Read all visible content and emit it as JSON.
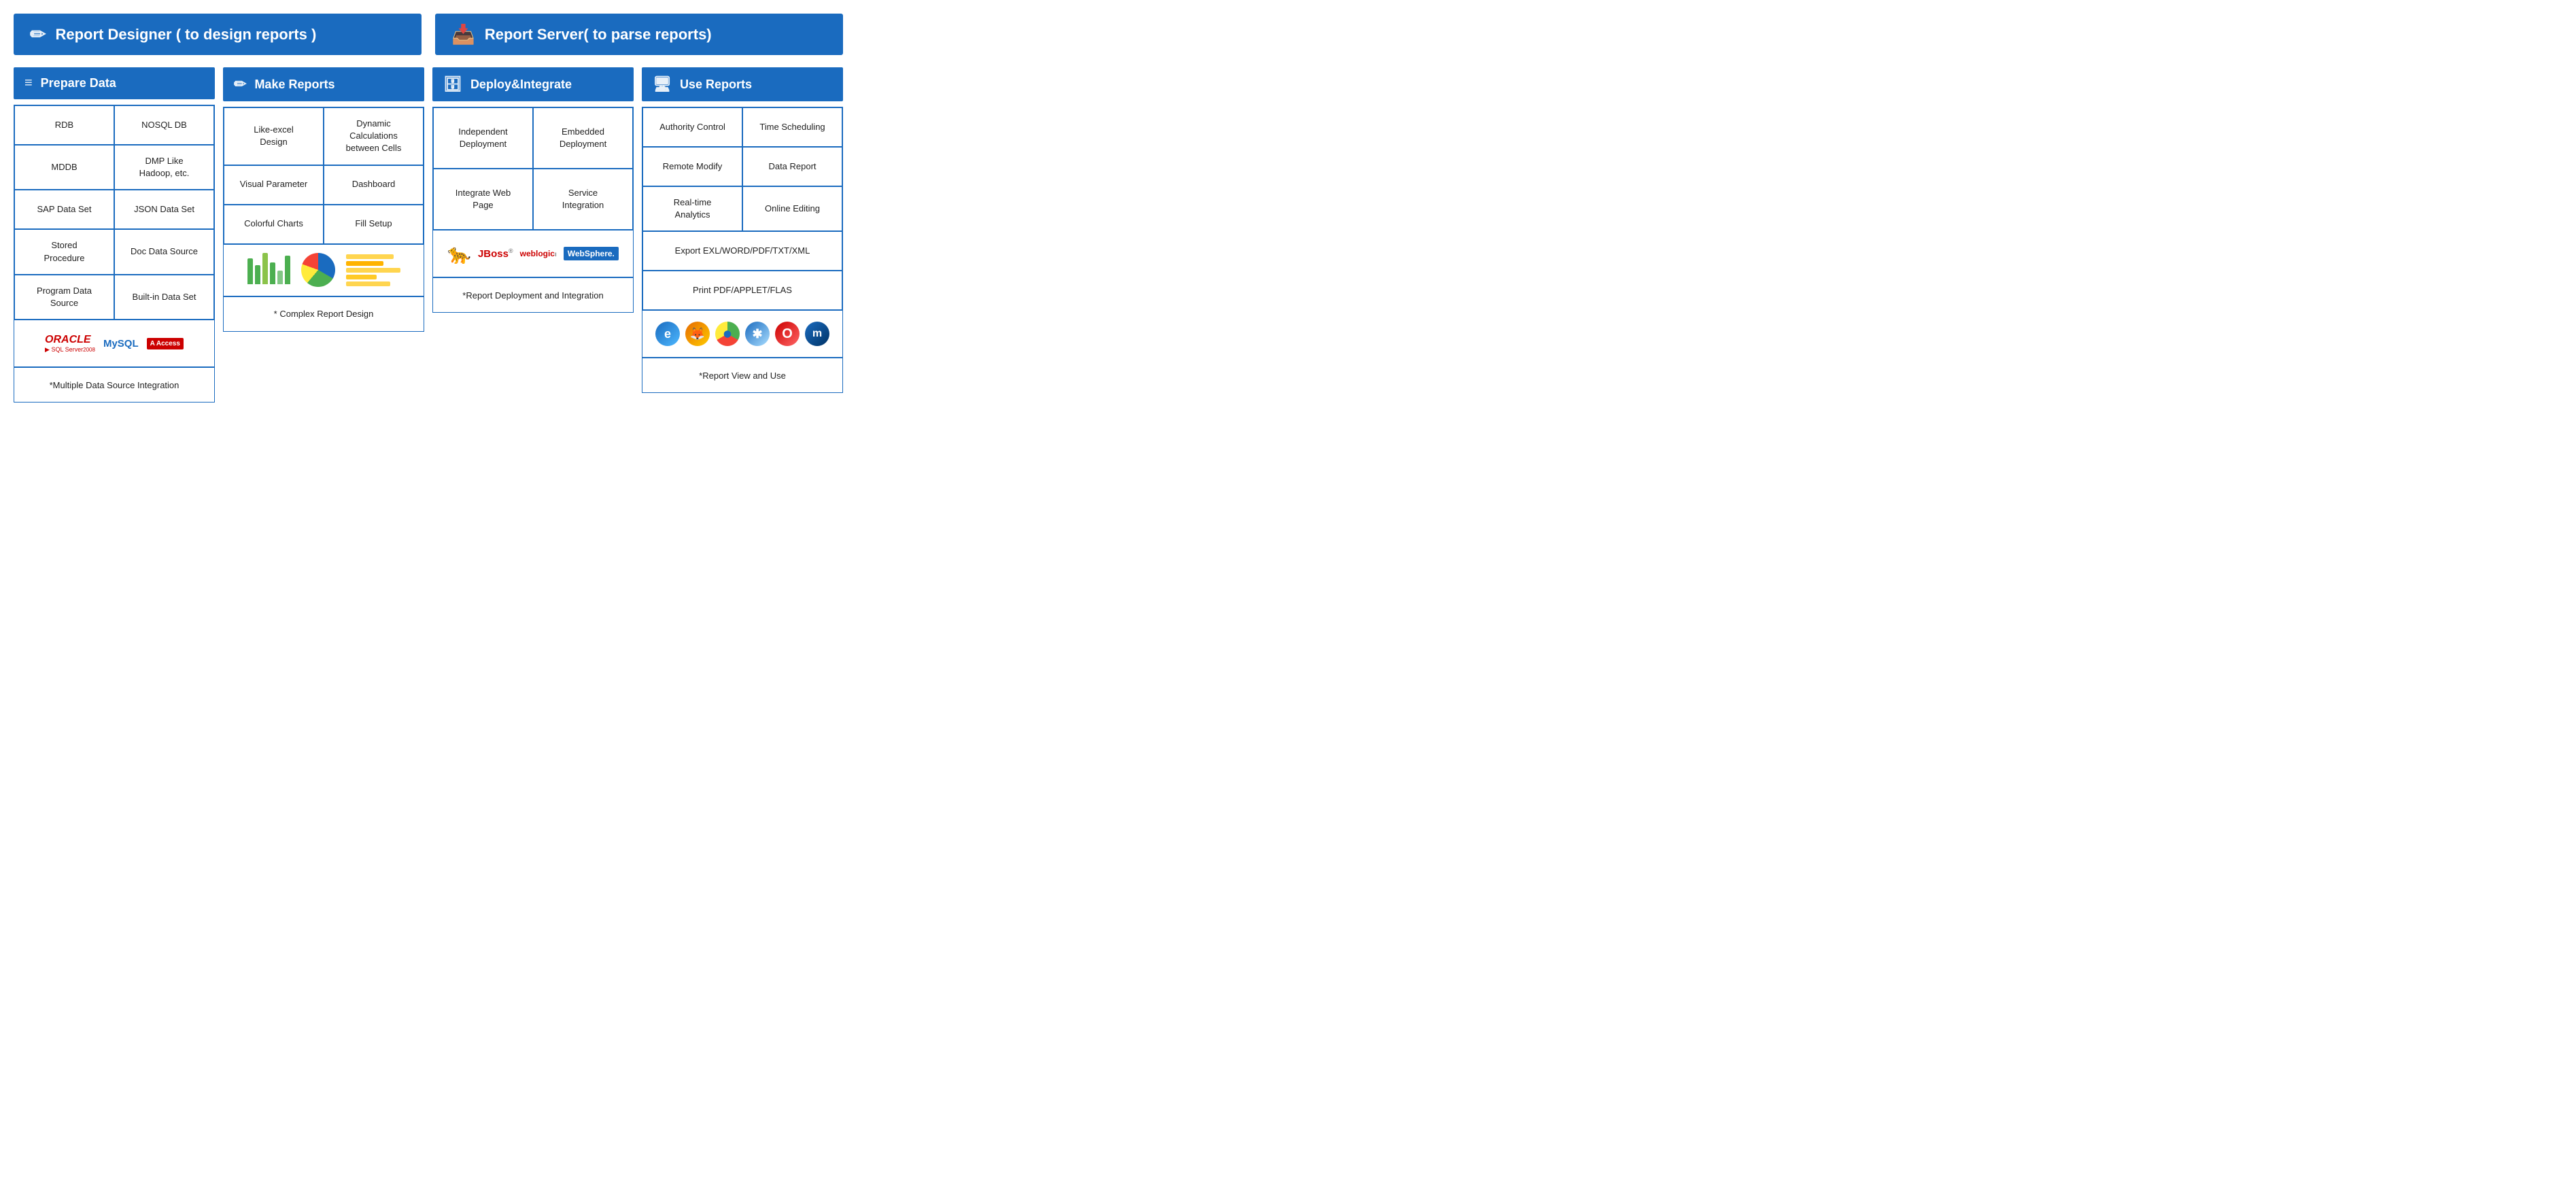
{
  "banners": {
    "designer": {
      "label": "Report Designer ( to design reports )",
      "icon": "✏️"
    },
    "server": {
      "label": "Report Server( to parse reports)",
      "icon": "📥"
    }
  },
  "sections": {
    "prepare_data": {
      "header": "Prepare Data",
      "icon": "≡",
      "features": [
        {
          "label": "RDB"
        },
        {
          "label": "NOSQL DB"
        },
        {
          "label": "MDDB"
        },
        {
          "label": "DMP Like\nHadoop, etc."
        },
        {
          "label": "SAP Data Set"
        },
        {
          "label": "JSON Data Set"
        },
        {
          "label": "Stored\nProcedure"
        },
        {
          "label": "Doc Data Source"
        },
        {
          "label": "Program Data\nSource"
        },
        {
          "label": "Built-in Data Set"
        }
      ],
      "bottom_note": "*Multiple Data Source Integration"
    },
    "make_reports": {
      "header": "Make Reports",
      "icon": "✏️",
      "features": [
        {
          "label": "Like-excel\nDesign"
        },
        {
          "label": "Dynamic\nCalculations\nbetween Cells"
        },
        {
          "label": "Visual Parameter"
        },
        {
          "label": "Dashboard"
        },
        {
          "label": "Colorful Charts"
        },
        {
          "label": "Fill Setup"
        }
      ],
      "bottom_note": "* Complex Report Design"
    },
    "deploy_integrate": {
      "header": "Deploy&Integrate",
      "icon": "🗄️",
      "features": [
        {
          "label": "Independent\nDeployment"
        },
        {
          "label": "Embedded\nDeployment"
        },
        {
          "label": "Integrate Web\nPage"
        },
        {
          "label": "Service\nIntegration"
        }
      ],
      "bottom_note": "*Report Deployment and\nIntegration"
    },
    "use_reports": {
      "header": "Use Reports",
      "icon": "🖥️",
      "features": [
        {
          "label": "Authority Control"
        },
        {
          "label": "Time Scheduling"
        },
        {
          "label": "Remote Modify"
        },
        {
          "label": "Data Report"
        },
        {
          "label": "Real-time\nAnalytics"
        },
        {
          "label": "Online Editing"
        },
        {
          "label": "Export EXL/WORD/PDF/TXT/XML",
          "full": true
        },
        {
          "label": "Print PDF/APPLET/FLAS",
          "full": true
        }
      ],
      "bottom_note": "*Report View and Use"
    }
  },
  "logos": {
    "prepare_data": [
      "ORACLE",
      "MySQL",
      "Access"
    ],
    "deploy": [
      "🐆",
      "JBoss",
      "weblogic",
      "WebSphere"
    ],
    "browsers": [
      "IE",
      "FF",
      "Chrome",
      "Safari",
      "Opera",
      "Maxthon"
    ]
  }
}
